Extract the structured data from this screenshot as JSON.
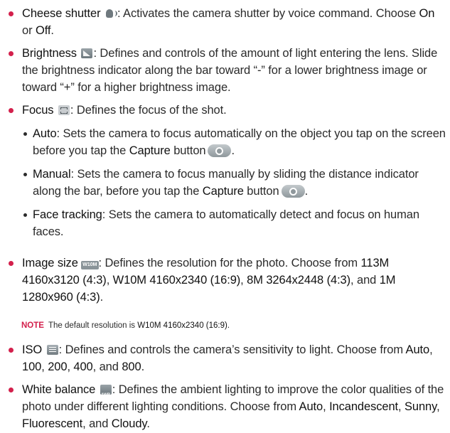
{
  "items": {
    "shutter": {
      "term": "Cheese shutter",
      "icon": "cheese-shutter-icon",
      "text1": ": Activates the camera shutter by voice command. Choose ",
      "on": "On",
      "or": " or ",
      "off": "Off",
      "end": "."
    },
    "brightness": {
      "term": "Brightness",
      "icon": "brightness-icon",
      "text": ": Defines and controls of the amount of light entering the lens. Slide the brightness indicator along the bar toward “-” for a lower brightness image or toward “+” for a higher brightness image."
    },
    "focus": {
      "term": "Focus",
      "icon": "focus-icon",
      "text": ": Defines the focus of the shot.",
      "auto": {
        "term": "Auto",
        "text": ": Sets the camera to focus automatically on the object you tap on the screen before you tap the ",
        "capture": "Capture",
        "text2": " button"
      },
      "manual": {
        "term": "Manual",
        "text": ": Sets the camera to focus manually by sliding the distance indicator along the bar, before you tap the ",
        "capture": "Capture",
        "text2": " button"
      },
      "face": {
        "term": "Face tracking",
        "text": ": Sets the camera to automatically detect and focus on human faces."
      },
      "end": "."
    },
    "image_size": {
      "term": "Image size",
      "badge": "W10M",
      "text1": ": Defines the resolution for the photo. Choose from ",
      "opt1": "113M 4160x3120 (4:3)",
      "sep1": ", ",
      "opt2": "W10M 4160x2340 (16:9)",
      "sep2": ", ",
      "opt3": "8M 3264x2448 (4:3)",
      "sep3": ", and ",
      "opt4": "1M 1280x960 (4:3)",
      "end": "."
    },
    "note": {
      "label": "NOTE",
      "text": "The default resolution is ",
      "value": "W10M 4160x2340 (16:9)",
      "end": "."
    },
    "iso": {
      "term": "ISO",
      "icon": "iso-icon",
      "text1": ": Defines and controls the camera’s sensitivity to light. Choose from ",
      "o1": "Auto",
      "s1": ", ",
      "o2": "100",
      "s2": ", ",
      "o3": "200",
      "s3": ", ",
      "o4": "400",
      "s4": ", and ",
      "o5": "800",
      "end": "."
    },
    "wb": {
      "term": "White balance",
      "icon": "white-balance-icon",
      "text1": ": Defines the ambient lighting to improve the color qualities of the photo under different lighting conditions. Choose from ",
      "o1": "Auto",
      "s1": ", ",
      "o2": "Incandescent",
      "s2": ", ",
      "o3": "Sunny",
      "s3": ", ",
      "o4": "Fluorescent",
      "s4": ", and ",
      "o5": "Cloudy",
      "end": "."
    }
  },
  "colors": {
    "bullet": "#d3204c",
    "text": "#2b2b2b",
    "note_label": "#d3204c"
  }
}
